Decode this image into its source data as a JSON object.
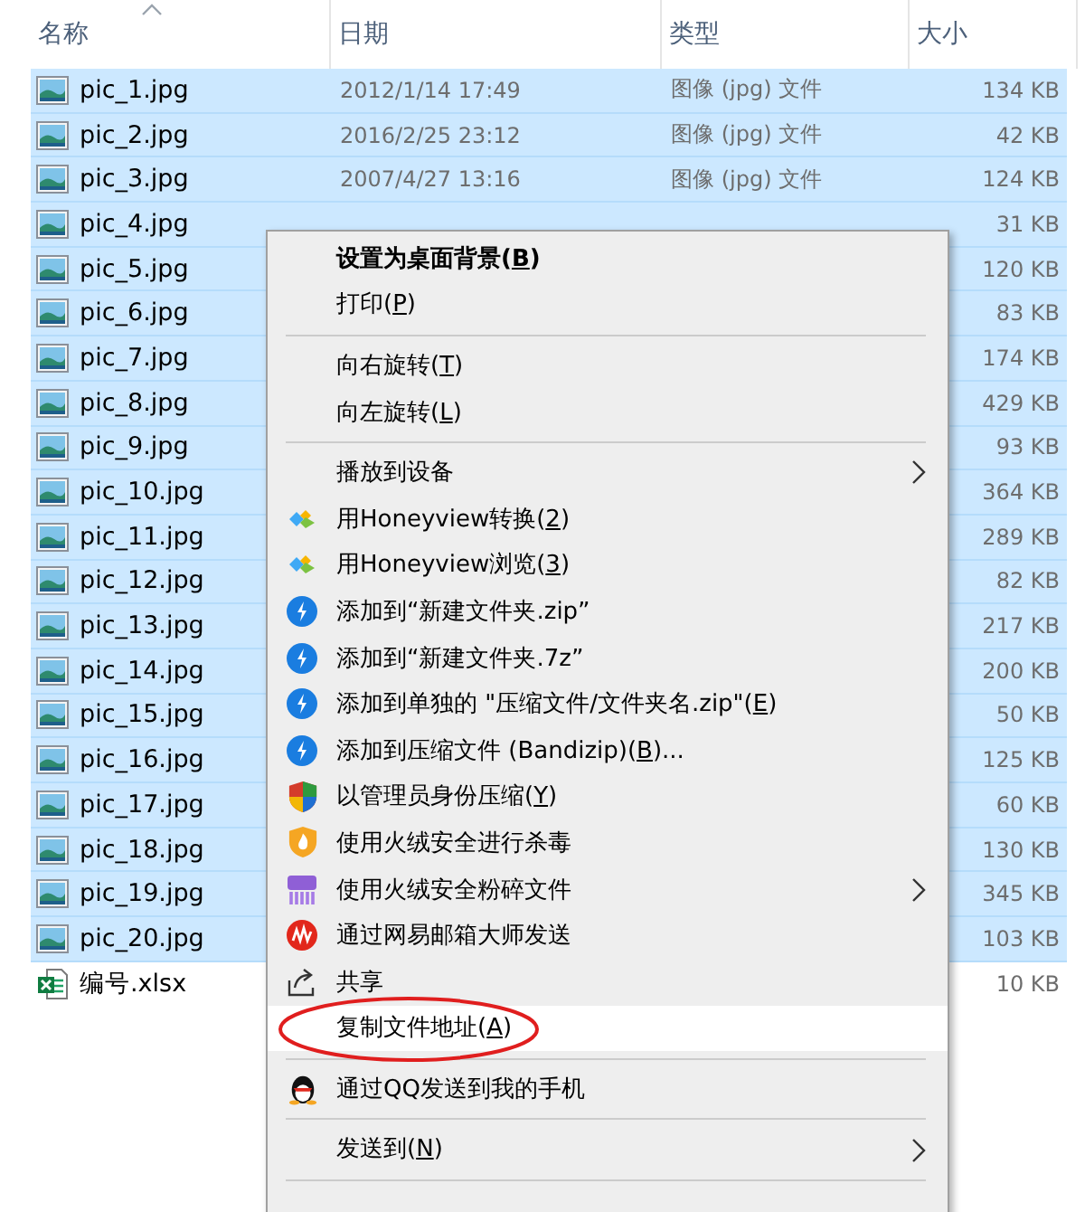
{
  "columns": [
    {
      "label": "名称",
      "sorted": true
    },
    {
      "label": "日期",
      "sorted": false
    },
    {
      "label": "类型",
      "sorted": false
    },
    {
      "label": "大小",
      "sorted": false
    }
  ],
  "files": [
    {
      "kind": "image",
      "name": "pic_1.jpg",
      "date": "2012/1/14 17:49",
      "type": "图像 (jpg) 文件",
      "size": "134 KB",
      "selected": true
    },
    {
      "kind": "image",
      "name": "pic_2.jpg",
      "date": "2016/2/25 23:12",
      "type": "图像 (jpg) 文件",
      "size": "42 KB",
      "selected": true
    },
    {
      "kind": "image",
      "name": "pic_3.jpg",
      "date": "2007/4/27 13:16",
      "type": "图像 (jpg) 文件",
      "size": "124 KB",
      "selected": true
    },
    {
      "kind": "image",
      "name": "pic_4.jpg",
      "size": "31 KB",
      "selected": true
    },
    {
      "kind": "image",
      "name": "pic_5.jpg",
      "size": "120 KB",
      "selected": true
    },
    {
      "kind": "image",
      "name": "pic_6.jpg",
      "size": "83 KB",
      "selected": true
    },
    {
      "kind": "image",
      "name": "pic_7.jpg",
      "size": "174 KB",
      "selected": true
    },
    {
      "kind": "image",
      "name": "pic_8.jpg",
      "size": "429 KB",
      "selected": true
    },
    {
      "kind": "image",
      "name": "pic_9.jpg",
      "size": "93 KB",
      "selected": true
    },
    {
      "kind": "image",
      "name": "pic_10.jpg",
      "size": "364 KB",
      "selected": true
    },
    {
      "kind": "image",
      "name": "pic_11.jpg",
      "size": "289 KB",
      "selected": true
    },
    {
      "kind": "image",
      "name": "pic_12.jpg",
      "size": "82 KB",
      "selected": true
    },
    {
      "kind": "image",
      "name": "pic_13.jpg",
      "size": "217 KB",
      "selected": true
    },
    {
      "kind": "image",
      "name": "pic_14.jpg",
      "size": "200 KB",
      "selected": true
    },
    {
      "kind": "image",
      "name": "pic_15.jpg",
      "size": "50 KB",
      "selected": true
    },
    {
      "kind": "image",
      "name": "pic_16.jpg",
      "size": "125 KB",
      "selected": true
    },
    {
      "kind": "image",
      "name": "pic_17.jpg",
      "size": "60 KB",
      "selected": true
    },
    {
      "kind": "image",
      "name": "pic_18.jpg",
      "size": "130 KB",
      "selected": true
    },
    {
      "kind": "image",
      "name": "pic_19.jpg",
      "size": "345 KB",
      "selected": true
    },
    {
      "kind": "image",
      "name": "pic_20.jpg",
      "size": "103 KB",
      "selected": true
    },
    {
      "kind": "excel",
      "name": "编号.xlsx",
      "size": "10 KB",
      "selected": false
    }
  ],
  "context_menu": [
    {
      "kind": "item",
      "before": "设置为桌面背景(",
      "key": "B",
      "after": ")",
      "bold": true,
      "submenu": false,
      "highlighted": false,
      "circled": false
    },
    {
      "kind": "item",
      "before": "打印(",
      "key": "P",
      "after": ")",
      "bold": false,
      "submenu": false,
      "highlighted": false,
      "circled": false
    },
    {
      "kind": "separator"
    },
    {
      "kind": "item",
      "before": "向右旋转(",
      "key": "T",
      "after": ")",
      "bold": false,
      "submenu": false,
      "highlighted": false,
      "circled": false
    },
    {
      "kind": "item",
      "before": "向左旋转(",
      "key": "L",
      "after": ")",
      "bold": false,
      "submenu": false,
      "highlighted": false,
      "circled": false
    },
    {
      "kind": "separator"
    },
    {
      "kind": "item",
      "before": "播放到设备",
      "bold": false,
      "submenu": true,
      "highlighted": false,
      "circled": false
    },
    {
      "kind": "honeyview",
      "before": "用Honeyview转换(",
      "key": "2",
      "after": ")",
      "bold": false,
      "submenu": false,
      "highlighted": false,
      "circled": false
    },
    {
      "kind": "honeyview",
      "before": "用Honeyview浏览(",
      "key": "3",
      "after": ")",
      "bold": false,
      "submenu": false,
      "highlighted": false,
      "circled": false
    },
    {
      "kind": "bandizip",
      "before": "添加到“新建文件夹.zip”",
      "bold": false,
      "submenu": false,
      "highlighted": false,
      "circled": false
    },
    {
      "kind": "bandizip",
      "before": "添加到“新建文件夹.7z”",
      "bold": false,
      "submenu": false,
      "highlighted": false,
      "circled": false
    },
    {
      "kind": "bandizip",
      "before": "添加到单独的 \"压缩文件/文件夹名.zip\"(",
      "key": "E",
      "after": ")",
      "bold": false,
      "submenu": false,
      "highlighted": false,
      "circled": false
    },
    {
      "kind": "bandizip",
      "before": "添加到压缩文件 (Bandizip)(",
      "key": "B",
      "after": ")...",
      "bold": false,
      "submenu": false,
      "highlighted": false,
      "circled": false
    },
    {
      "kind": "shield",
      "before": "以管理员身份压缩(",
      "key": "Y",
      "after": ")",
      "bold": false,
      "submenu": false,
      "highlighted": false,
      "circled": false
    },
    {
      "kind": "flame",
      "before": "使用火绒安全进行杀毒",
      "bold": false,
      "submenu": false,
      "highlighted": false,
      "circled": false
    },
    {
      "kind": "shredder",
      "before": "使用火绒安全粉碎文件",
      "bold": false,
      "submenu": true,
      "highlighted": false,
      "circled": false
    },
    {
      "kind": "mail",
      "before": "通过网易邮箱大师发送",
      "bold": false,
      "submenu": false,
      "highlighted": false,
      "circled": false
    },
    {
      "kind": "share",
      "before": "共享",
      "bold": false,
      "submenu": false,
      "highlighted": false,
      "circled": false
    },
    {
      "kind": "item",
      "before": "复制文件地址(",
      "key": "A",
      "after": ")",
      "bold": false,
      "submenu": false,
      "highlighted": true,
      "circled": true
    },
    {
      "kind": "separator"
    },
    {
      "kind": "qq",
      "before": "通过QQ发送到我的手机",
      "bold": false,
      "submenu": false,
      "highlighted": false,
      "circled": false
    },
    {
      "kind": "separator"
    },
    {
      "kind": "item",
      "before": "发送到(",
      "key": "N",
      "after": ")",
      "bold": false,
      "submenu": true,
      "highlighted": false,
      "circled": false
    },
    {
      "kind": "separator"
    }
  ]
}
